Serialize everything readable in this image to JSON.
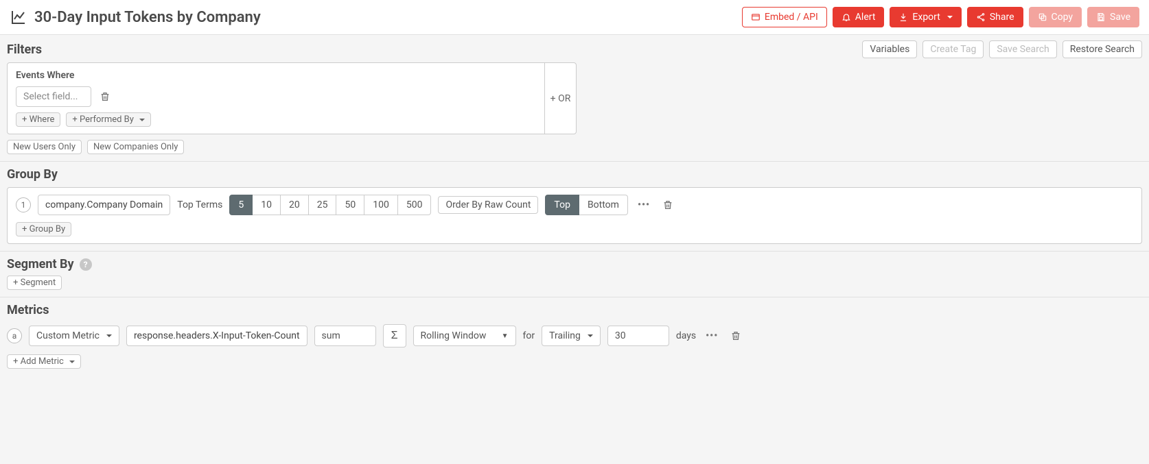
{
  "header": {
    "title": "30-Day Input Tokens by Company",
    "embed_api": "Embed / API",
    "alert": "Alert",
    "export": "Export",
    "share": "Share",
    "copy": "Copy",
    "save": "Save"
  },
  "filters": {
    "title": "Filters",
    "variables": "Variables",
    "create_tag": "Create Tag",
    "save_search": "Save Search",
    "restore_search": "Restore Search",
    "events_where": "Events Where",
    "select_field_placeholder": "Select field...",
    "add_where": "+ Where",
    "add_performed_by": "+ Performed By",
    "or_label": "+ OR",
    "new_users_only": "New Users Only",
    "new_companies_only": "New Companies Only"
  },
  "groupby": {
    "title": "Group By",
    "badge": "1",
    "field": "company.Company Domain",
    "top_terms": "Top Terms",
    "counts": [
      "5",
      "10",
      "20",
      "25",
      "50",
      "100",
      "500"
    ],
    "active_count": "5",
    "order_by": "Order By Raw Count",
    "top": "Top",
    "bottom": "Bottom",
    "add_group_by": "+ Group By"
  },
  "segmentby": {
    "title": "Segment By",
    "add_segment": "+ Segment"
  },
  "metrics": {
    "title": "Metrics",
    "badge": "a",
    "custom_metric": "Custom Metric",
    "field": "response.headers.X-Input-Token-Count",
    "agg": "sum",
    "rolling_window": "Rolling Window",
    "for": "for",
    "trailing": "Trailing",
    "value": "30",
    "days": "days",
    "add_metric": "+ Add Metric"
  }
}
